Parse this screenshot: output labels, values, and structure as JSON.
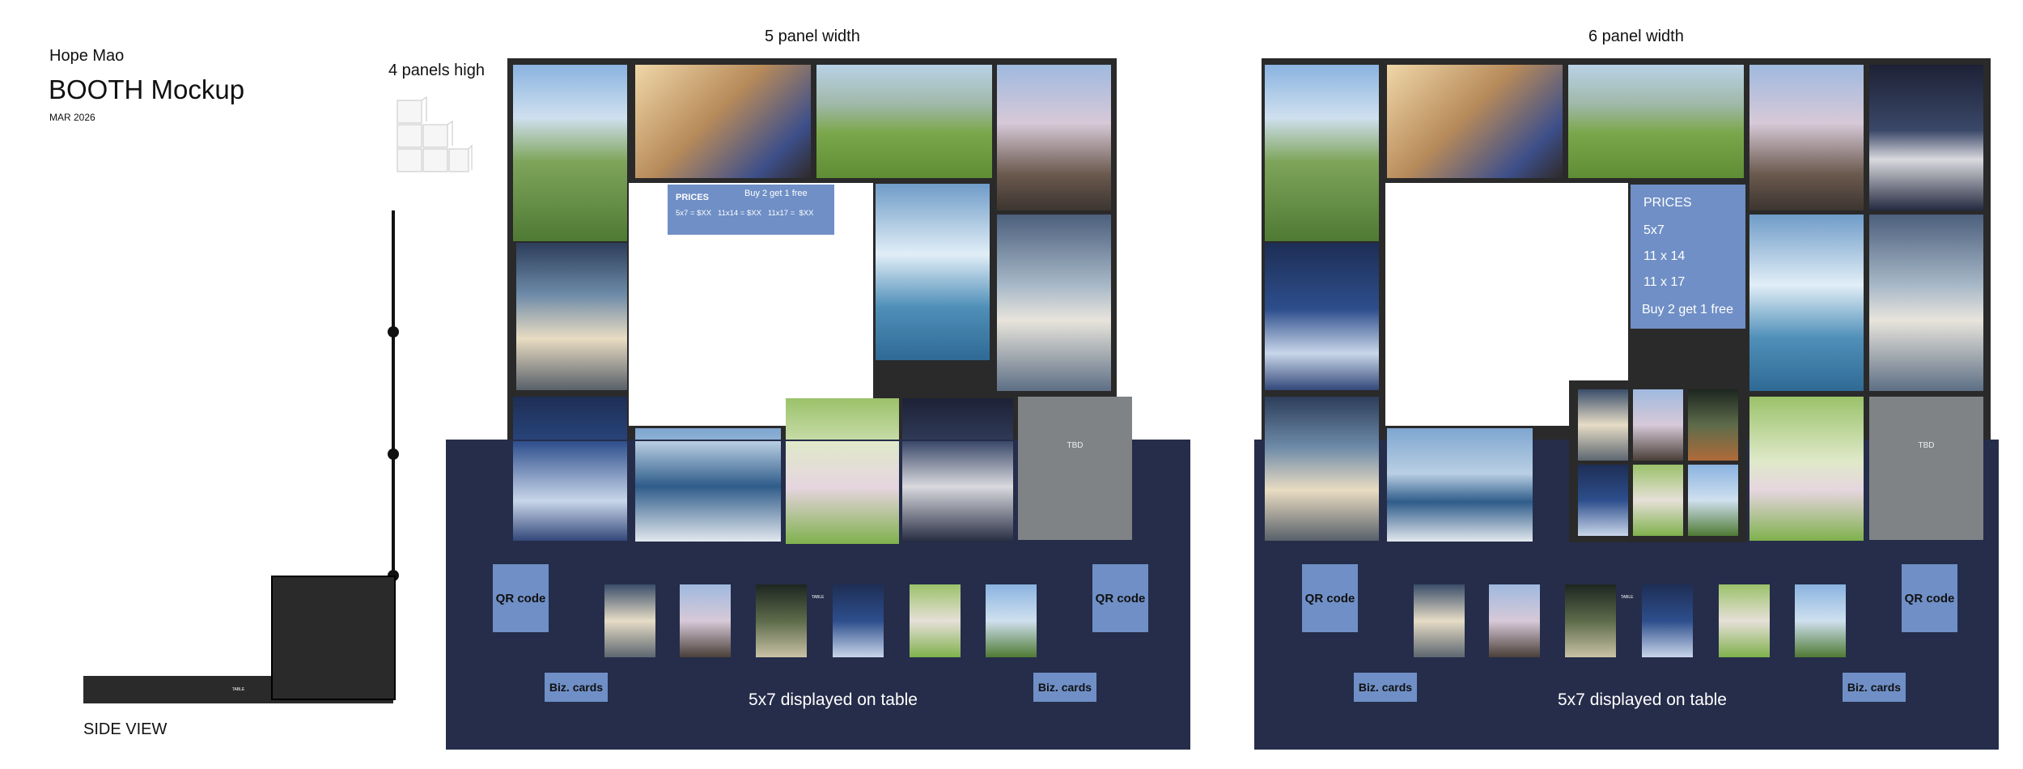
{
  "header": {
    "author": "Hope Mao",
    "title": "BOOTH Mockup",
    "date": "MAR 2026"
  },
  "side": {
    "panels_high": "4 panels high",
    "side_view": "SIDE VIEW",
    "table_tag": "TABLE"
  },
  "layout_a": {
    "heading": "5 panel width",
    "prices": {
      "title": "PRICES",
      "promo": "Buy 2 get 1 free",
      "line": "5x7 = $XX   11x14 = $XX   11x17 =  $XX"
    },
    "tbd": "TBD",
    "qr_left": "QR code",
    "qr_right": "QR code",
    "biz_left": "Biz. cards",
    "biz_right": "Biz. cards",
    "table_caption": "5x7 displayed on table",
    "tag": "TABLE"
  },
  "layout_b": {
    "heading": "6 panel width",
    "prices": {
      "title": "PRICES",
      "items": [
        "5x7",
        "11 x 14",
        "11 x 17"
      ],
      "promo": "Buy 2 get 1 free"
    },
    "tbd": "TBD",
    "qr_left": "QR code",
    "qr_right": "QR code",
    "biz_left": "Biz. cards",
    "biz_right": "Biz. cards",
    "table_caption": "5x7 displayed on table",
    "tag": "TABLE"
  },
  "colors": {
    "panel": "#2a2a2a",
    "table": "#252d4a",
    "label": "#6f8fc6",
    "tbd": "#808386"
  }
}
